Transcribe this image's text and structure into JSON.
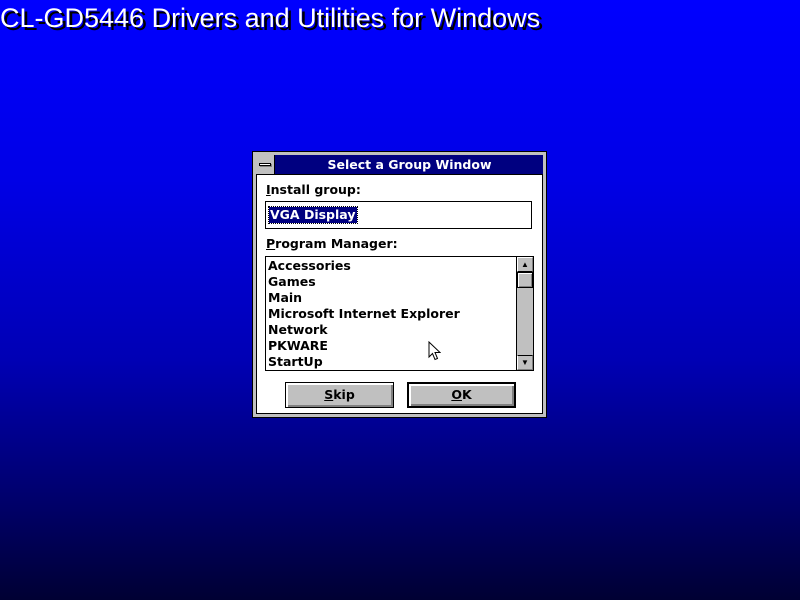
{
  "background": {
    "title": "CL-GD5446 Drivers and Utilities for Windows",
    "colors": {
      "top": "#0000ff",
      "bottom": "#000033",
      "title_text": "#ffffff"
    }
  },
  "dialog": {
    "title": "Select a Group Window",
    "install_group": {
      "label_mnemonic": "I",
      "label_rest": "nstall group:",
      "value": "VGA Display"
    },
    "program_manager": {
      "label_mnemonic": "P",
      "label_rest": "rogram Manager:",
      "items": [
        "Accessories",
        "Games",
        "Main",
        "Microsoft Internet Explorer",
        "Network",
        "PKWARE",
        "StartUp"
      ]
    },
    "buttons": {
      "skip": {
        "mnemonic": "S",
        "rest": "kip"
      },
      "ok": {
        "mnemonic": "O",
        "rest": "K"
      }
    },
    "colors": {
      "titlebar": "#000080",
      "face": "#c0c0c0",
      "selection": "#000080"
    },
    "icons": {
      "system_menu": "system-menu-icon",
      "scroll_up": "scroll-up-arrow-icon",
      "scroll_down": "scroll-down-arrow-icon",
      "pointer": "mouse-pointer-icon"
    }
  }
}
